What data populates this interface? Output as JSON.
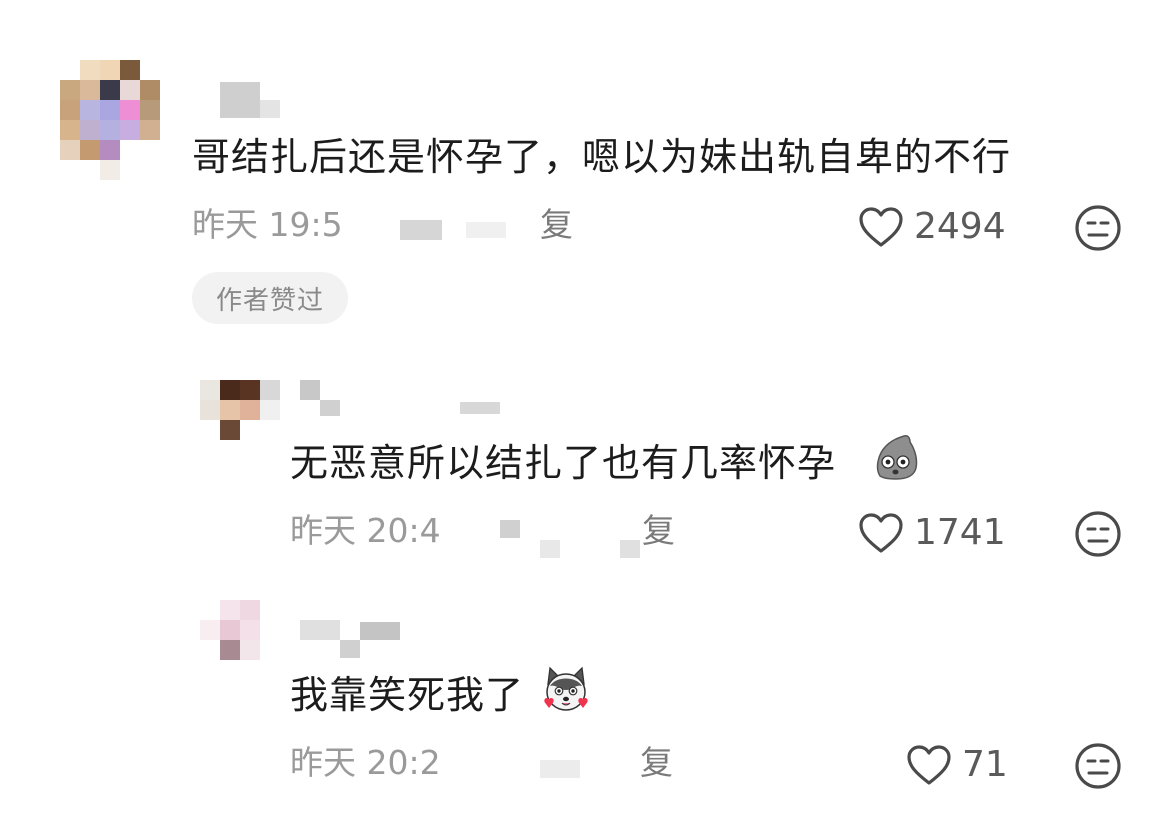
{
  "comments": [
    {
      "text": "哥结扎后还是怀孕了，嗯以为妹出轨自卑的不行",
      "time": "昨天 19:5",
      "reply_label": "复",
      "likes": "2494",
      "badge": "作者赞过"
    },
    {
      "text": "无恶意所以结扎了也有几率怀孕",
      "time": "昨天 20:4",
      "reply_label": "复",
      "likes": "1741",
      "emoji": "stone-face-emoji"
    },
    {
      "text": "我靠笑死我了",
      "time": "昨天 20:2",
      "reply_label": "复",
      "likes": "71",
      "emoji": "husky-emoji"
    }
  ],
  "icons": {
    "like": "heart-outline-icon",
    "dislike": "neutral-face-icon"
  },
  "colors": {
    "text": "#1c1c1c",
    "meta": "#9a9a9a",
    "icon": "#4a4a4a",
    "badge_bg": "#f2f2f2"
  }
}
